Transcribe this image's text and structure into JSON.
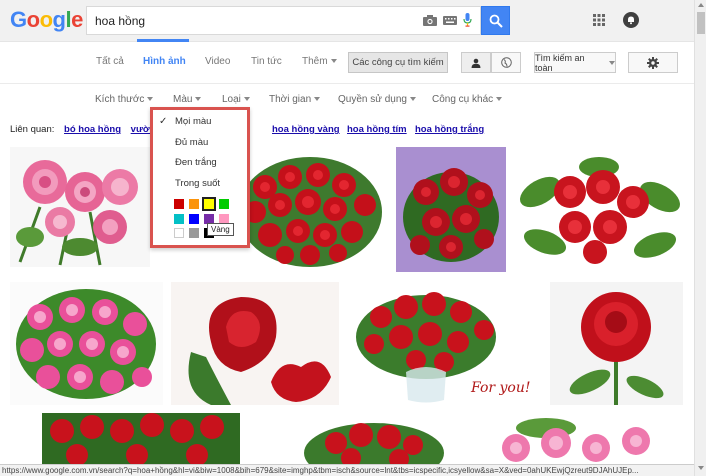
{
  "header": {
    "logo": [
      "G",
      "o",
      "o",
      "g",
      "l",
      "e"
    ],
    "logo_colors": [
      "#4285f4",
      "#ea4335",
      "#fbbc05",
      "#4285f4",
      "#34a853",
      "#ea4335"
    ],
    "search_value": "hoa hồng"
  },
  "tabs": {
    "all": "Tất cả",
    "images": "Hình ảnh",
    "video": "Video",
    "news": "Tin tức",
    "more": "Thêm",
    "search_tools": "Các công cụ tìm kiếm",
    "safe_search": "Tìm kiếm an toàn"
  },
  "filters": {
    "size": "Kích thước",
    "color": "Màu",
    "type": "Loại",
    "time": "Thời gian",
    "usage": "Quyền sử dụng",
    "more_tools": "Công cụ khác"
  },
  "related": {
    "label": "Liên quan:",
    "items": [
      "bó hoa hồng",
      "vườn"
    ],
    "right_items": [
      "hoa hồng vàng",
      "hoa hồng tím",
      "hoa hồng trắng"
    ]
  },
  "color_menu": {
    "items": [
      "Mọi màu",
      "Đủ màu",
      "Đen trắng",
      "Trong suốt"
    ],
    "checkmark": "✓",
    "tooltip": "Vàng",
    "swatches": [
      "#cc0000",
      "#fb940b",
      "#ffff00",
      "#00cc00",
      "#03c0c6",
      "#0000ff",
      "#762ca7",
      "#ff98bf",
      "#ffffff",
      "#999999",
      "#000000"
    ]
  },
  "status_bar": "https://www.google.com.vn/search?q=hoa+hồng&hl=vi&biw=1008&bih=679&site=imghp&tbm=isch&source=lnt&tbs=icspecific,icsyellow&sa=X&ved=0ahUKEwjQzreut9DJAhUJEp..."
}
